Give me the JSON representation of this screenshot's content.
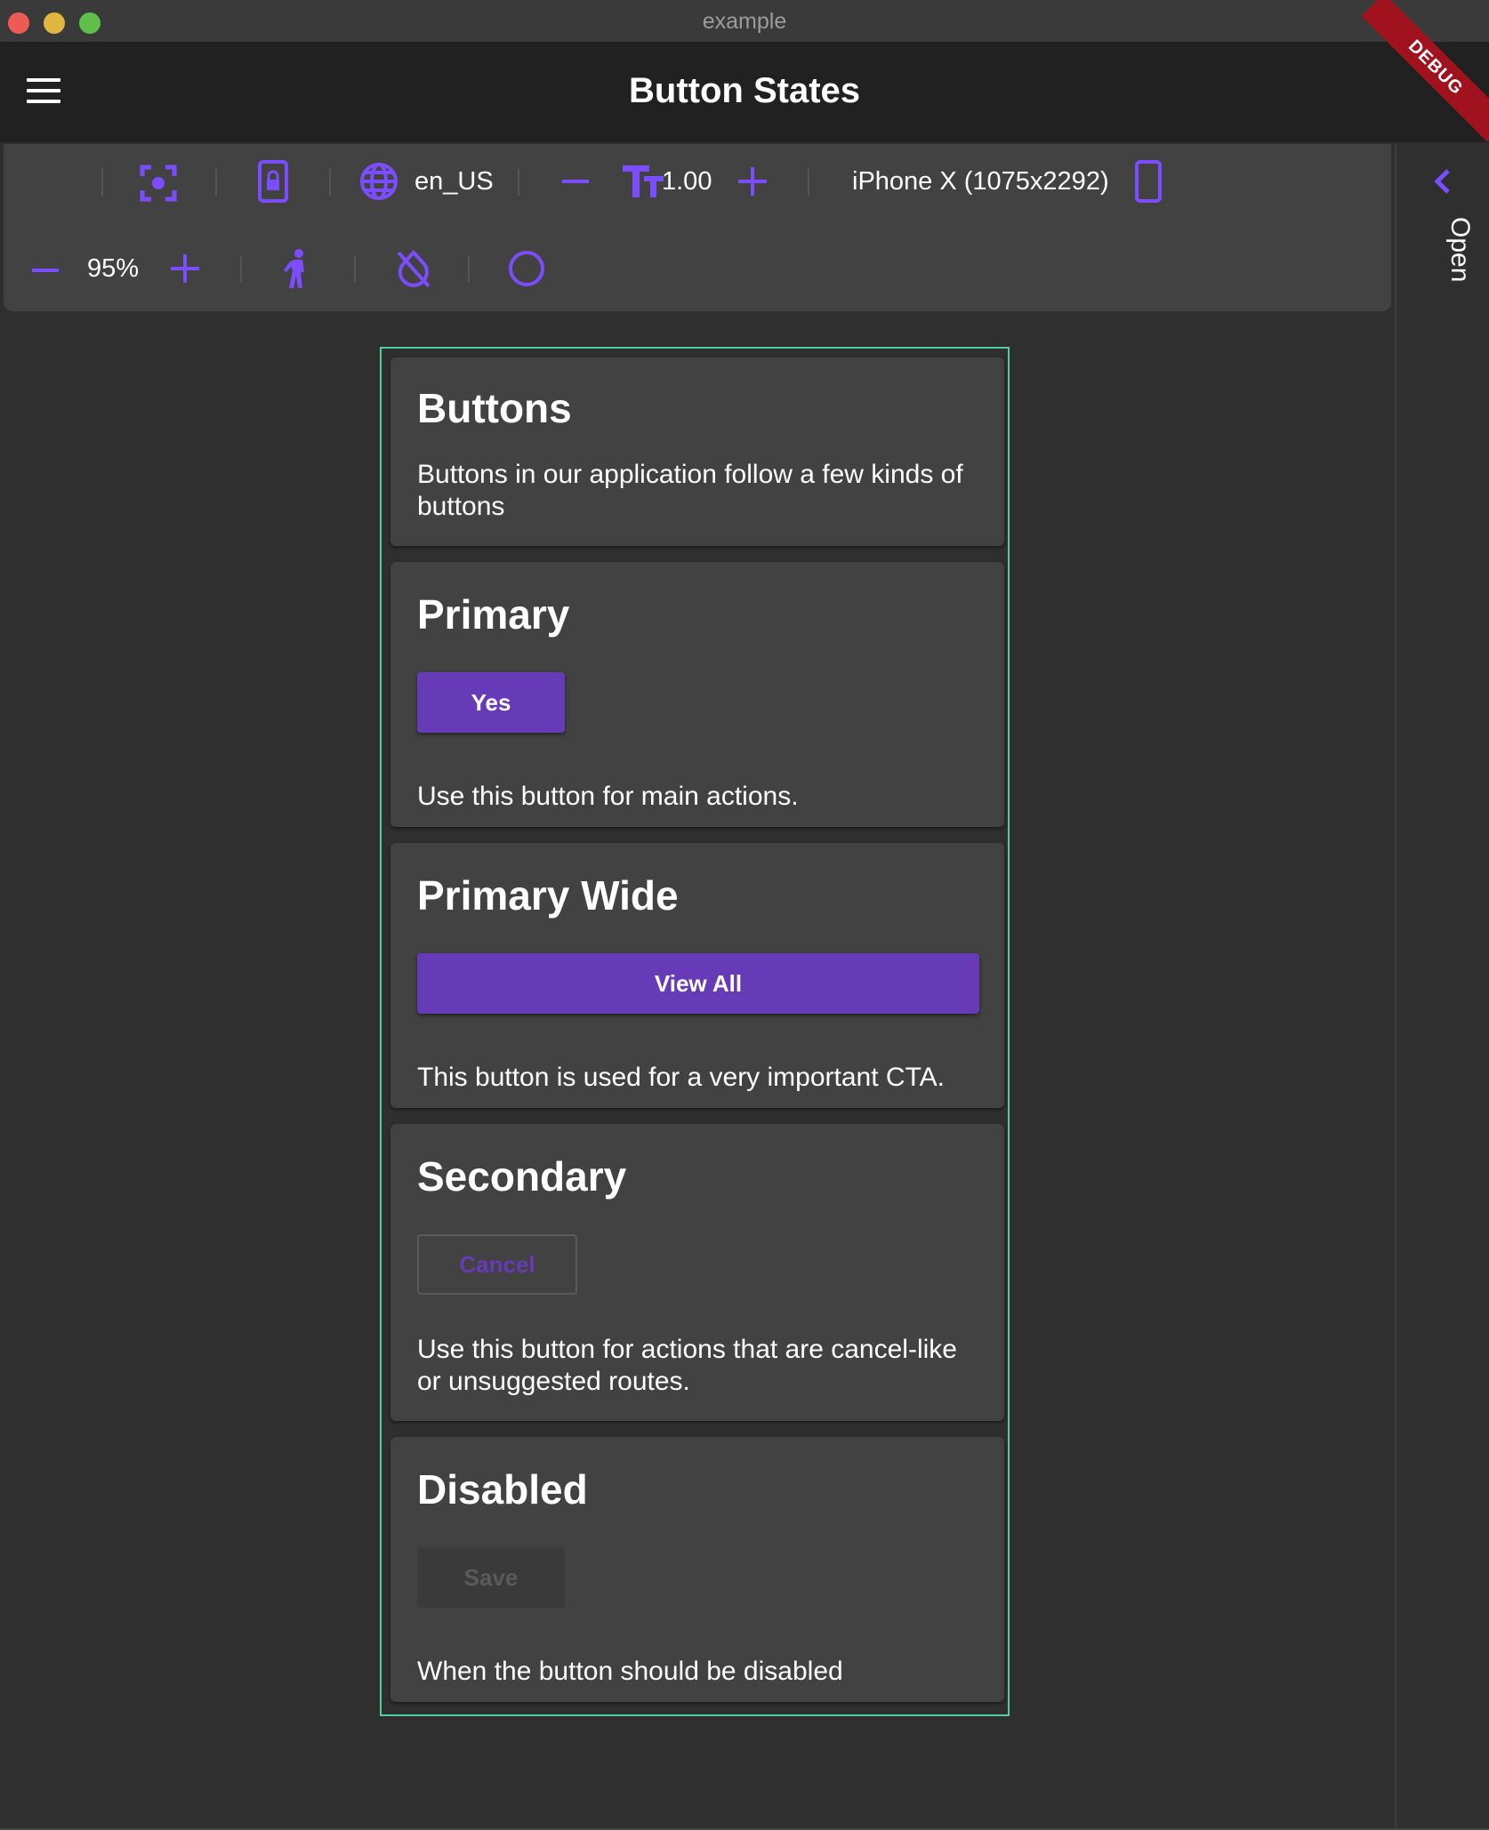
{
  "window": {
    "title": "example"
  },
  "appbar": {
    "title": "Button States",
    "debug_label": "DEBUG"
  },
  "toolbar": {
    "locale": "en_US",
    "text_scale": "1.00",
    "device": "iPhone X (1075x2292)",
    "zoom": "95%"
  },
  "drawer": {
    "open_label": "Open"
  },
  "cards": [
    {
      "title": "Buttons",
      "description": "Buttons in our application follow a few kinds of buttons"
    },
    {
      "title": "Primary",
      "button": "Yes",
      "description": "Use this button for main actions."
    },
    {
      "title": "Primary Wide",
      "button": "View All",
      "description": "This button is used for a very important CTA."
    },
    {
      "title": "Secondary",
      "button": "Cancel",
      "description": "Use this button for actions that are cancel-like or unsuggested routes."
    },
    {
      "title": "Disabled",
      "button": "Save",
      "description": "When the button should be disabled"
    }
  ],
  "colors": {
    "accent": "#7c4dff",
    "primary_button": "#673ab7",
    "device_border": "#4fcfa0",
    "debug_banner": "#a0121d"
  },
  "icons": [
    "dark-mode-icon",
    "screenshot-focus-icon",
    "phone-lock-icon",
    "globe-icon",
    "minus-icon",
    "text-size-icon",
    "plus-icon",
    "phone-icon",
    "walk-icon",
    "invert-colors-off-icon",
    "circle-icon",
    "chevron-left-icon",
    "menu-icon"
  ]
}
